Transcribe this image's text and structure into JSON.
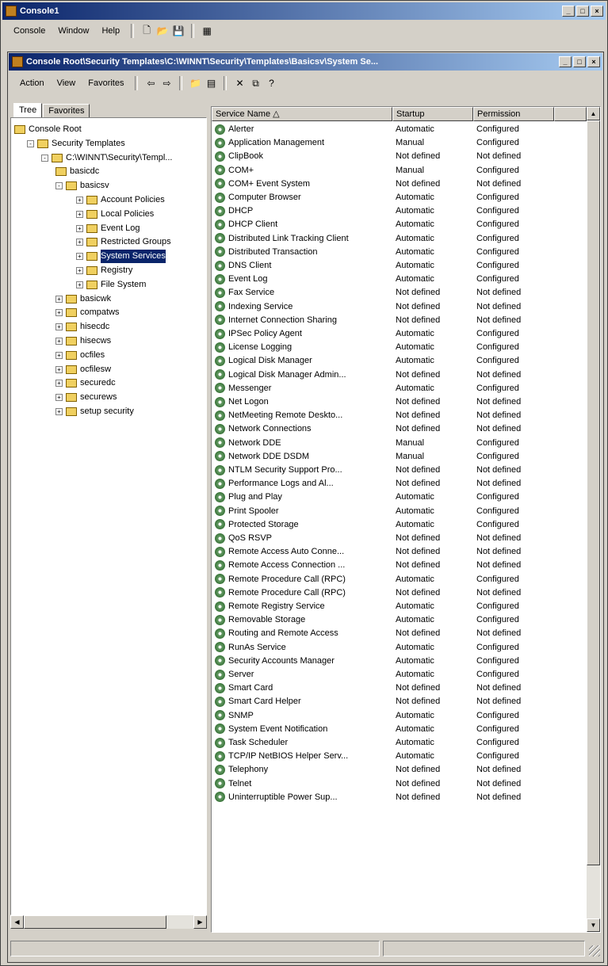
{
  "outer_window": {
    "title": "Console1",
    "buttons": [
      "_",
      "□",
      "×"
    ],
    "menu": [
      "Console",
      "Window",
      "Help"
    ]
  },
  "inner_window": {
    "title": "Console Root\\Security Templates\\C:\\WINNT\\Security\\Templates\\Basicsv\\System Se...",
    "buttons": [
      "_",
      "□",
      "×"
    ],
    "menu": [
      "Action",
      "View",
      "Favorites"
    ]
  },
  "tabs": [
    "Tree",
    "Favorites"
  ],
  "tree": [
    {
      "label": "Console Root",
      "indent": 0,
      "exp": ""
    },
    {
      "label": "Security Templates",
      "indent": 1,
      "exp": "-"
    },
    {
      "label": "C:\\WINNT\\Security\\Templ...",
      "indent": 2,
      "exp": "-"
    },
    {
      "label": "basicdc",
      "indent": 3,
      "exp": ""
    },
    {
      "label": "basicsv",
      "indent": 3,
      "exp": "-"
    },
    {
      "label": "Account Policies",
      "indent": 4,
      "exp": "+"
    },
    {
      "label": "Local Policies",
      "indent": 4,
      "exp": "+"
    },
    {
      "label": "Event Log",
      "indent": 4,
      "exp": "+"
    },
    {
      "label": "Restricted Groups",
      "indent": 4,
      "exp": "+"
    },
    {
      "label": "System Services",
      "indent": 4,
      "exp": "+",
      "selected": true
    },
    {
      "label": "Registry",
      "indent": 4,
      "exp": "+"
    },
    {
      "label": "File System",
      "indent": 4,
      "exp": "+"
    },
    {
      "label": "basicwk",
      "indent": 3,
      "exp": "+"
    },
    {
      "label": "compatws",
      "indent": 3,
      "exp": "+"
    },
    {
      "label": "hisecdc",
      "indent": 3,
      "exp": "+"
    },
    {
      "label": "hisecws",
      "indent": 3,
      "exp": "+"
    },
    {
      "label": "ocfiles",
      "indent": 3,
      "exp": "+"
    },
    {
      "label": "ocfilesw",
      "indent": 3,
      "exp": "+"
    },
    {
      "label": "securedc",
      "indent": 3,
      "exp": "+"
    },
    {
      "label": "securews",
      "indent": 3,
      "exp": "+"
    },
    {
      "label": "setup security",
      "indent": 3,
      "exp": "+"
    }
  ],
  "columns": [
    "Service Name",
    "Startup",
    "Permission"
  ],
  "services": [
    [
      "Alerter",
      "Automatic",
      "Configured"
    ],
    [
      "Application Management",
      "Manual",
      "Configured"
    ],
    [
      "ClipBook",
      "Not defined",
      "Not defined"
    ],
    [
      "COM+",
      "Manual",
      "Configured"
    ],
    [
      "COM+ Event System",
      "Not defined",
      "Not defined"
    ],
    [
      "Computer Browser",
      "Automatic",
      "Configured"
    ],
    [
      "DHCP",
      "Automatic",
      "Configured"
    ],
    [
      "DHCP Client",
      "Automatic",
      "Configured"
    ],
    [
      "Distributed Link Tracking Client",
      "Automatic",
      "Configured"
    ],
    [
      "Distributed Transaction",
      "Automatic",
      "Configured"
    ],
    [
      "DNS Client",
      "Automatic",
      "Configured"
    ],
    [
      "Event Log",
      "Automatic",
      "Configured"
    ],
    [
      "Fax Service",
      "Not defined",
      "Not defined"
    ],
    [
      "Indexing Service",
      "Not defined",
      "Not defined"
    ],
    [
      "Internet Connection Sharing",
      "Not defined",
      "Not defined"
    ],
    [
      "IPSec Policy Agent",
      "Automatic",
      "Configured"
    ],
    [
      "License Logging",
      "Automatic",
      "Configured"
    ],
    [
      "Logical Disk Manager",
      "Automatic",
      "Configured"
    ],
    [
      "Logical Disk Manager Admin...",
      "Not defined",
      "Not defined"
    ],
    [
      "Messenger",
      "Automatic",
      "Configured"
    ],
    [
      "Net Logon",
      "Not defined",
      "Not defined"
    ],
    [
      "NetMeeting Remote Deskto...",
      "Not defined",
      "Not defined"
    ],
    [
      "Network Connections",
      "Not defined",
      "Not defined"
    ],
    [
      "Network DDE",
      "Manual",
      "Configured"
    ],
    [
      "Network DDE DSDM",
      "Manual",
      "Configured"
    ],
    [
      "NTLM Security Support Pro...",
      "Not defined",
      "Not defined"
    ],
    [
      "Performance Logs and Al...",
      "Not defined",
      "Not defined"
    ],
    [
      "Plug and Play",
      "Automatic",
      "Configured"
    ],
    [
      "Print Spooler",
      "Automatic",
      "Configured"
    ],
    [
      "Protected Storage",
      "Automatic",
      "Configured"
    ],
    [
      "QoS RSVP",
      "Not defined",
      "Not defined"
    ],
    [
      "Remote Access Auto Conne...",
      "Not defined",
      "Not defined"
    ],
    [
      "Remote Access Connection ...",
      "Not defined",
      "Not defined"
    ],
    [
      "Remote Procedure Call (RPC)",
      "Automatic",
      "Configured"
    ],
    [
      "Remote Procedure Call (RPC)",
      "Not defined",
      "Not defined"
    ],
    [
      "Remote Registry Service",
      "Automatic",
      "Configured"
    ],
    [
      "Removable Storage",
      "Automatic",
      "Configured"
    ],
    [
      "Routing and Remote Access",
      "Not defined",
      "Not defined"
    ],
    [
      "RunAs Service",
      "Automatic",
      "Configured"
    ],
    [
      "Security Accounts Manager",
      "Automatic",
      "Configured"
    ],
    [
      "Server",
      "Automatic",
      "Configured"
    ],
    [
      "Smart Card",
      "Not defined",
      "Not defined"
    ],
    [
      "Smart Card Helper",
      "Not defined",
      "Not defined"
    ],
    [
      "SNMP",
      "Automatic",
      "Configured"
    ],
    [
      "System Event Notification",
      "Automatic",
      "Configured"
    ],
    [
      "Task Scheduler",
      "Automatic",
      "Configured"
    ],
    [
      "TCP/IP NetBIOS Helper Serv...",
      "Automatic",
      "Configured"
    ],
    [
      "Telephony",
      "Not defined",
      "Not defined"
    ],
    [
      "Telnet",
      "Not defined",
      "Not defined"
    ],
    [
      "Uninterruptible Power Sup...",
      "Not defined",
      "Not defined"
    ]
  ]
}
